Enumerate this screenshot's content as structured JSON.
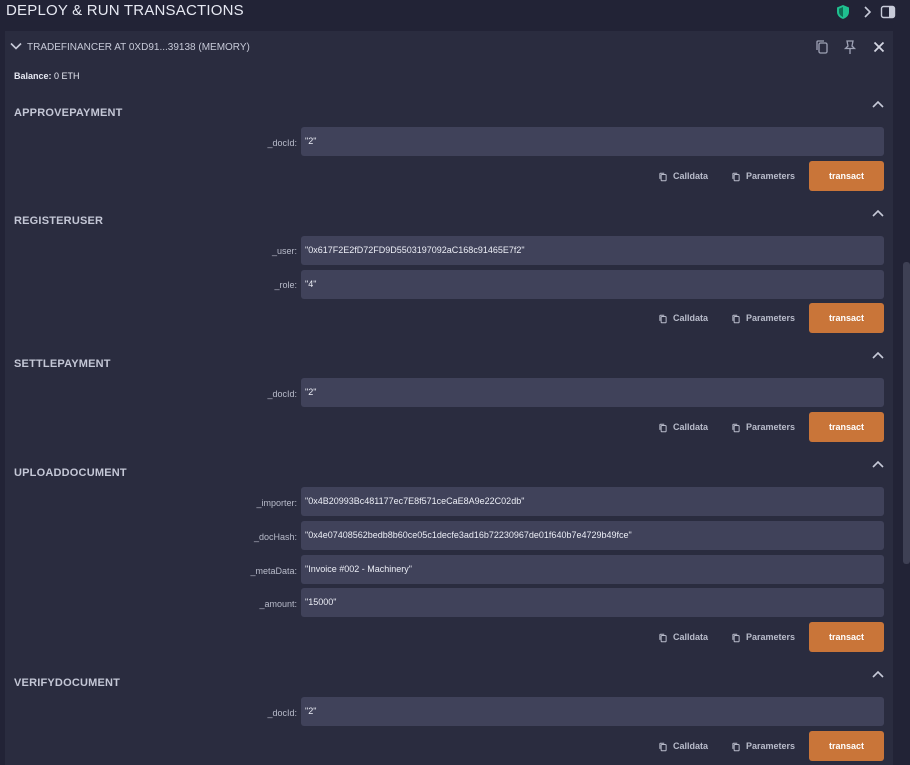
{
  "header": {
    "title": "DEPLOY & RUN TRANSACTIONS"
  },
  "contract": {
    "name": "TRADEFINANCER AT 0XD91...39138 (MEMORY)",
    "balance_label": "Balance:",
    "balance_value": "0 ETH"
  },
  "labels": {
    "calldata": "Calldata",
    "parameters": "Parameters",
    "transact": "transact"
  },
  "functions": [
    {
      "name": "APPROVEPAYMENT",
      "params": [
        {
          "label": "_docId:",
          "value": "\"2\""
        }
      ]
    },
    {
      "name": "REGISTERUSER",
      "params": [
        {
          "label": "_user:",
          "value": "\"0x617F2E2fD72FD9D5503197092aC168c91465E7f2\""
        },
        {
          "label": "_role:",
          "value": "\"4\""
        }
      ]
    },
    {
      "name": "SETTLEPAYMENT",
      "params": [
        {
          "label": "_docId:",
          "value": "\"2\""
        }
      ]
    },
    {
      "name": "UPLOADDOCUMENT",
      "params": [
        {
          "label": "_importer:",
          "value": "\"0x4B20993Bc481177ec7E8f571ceCaE8A9e22C02db\""
        },
        {
          "label": "_docHash:",
          "value": "\"0x4e07408562bedb8b60ce05c1decfe3ad16b72230967de01f640b7e4729b49fce\""
        },
        {
          "label": "_metaData:",
          "value": "\"Invoice #002 - Machinery\""
        },
        {
          "label": "_amount:",
          "value": "\"15000\""
        }
      ]
    },
    {
      "name": "VERIFYDOCUMENT",
      "params": [
        {
          "label": "_docId:",
          "value": "\"2\""
        }
      ]
    }
  ]
}
